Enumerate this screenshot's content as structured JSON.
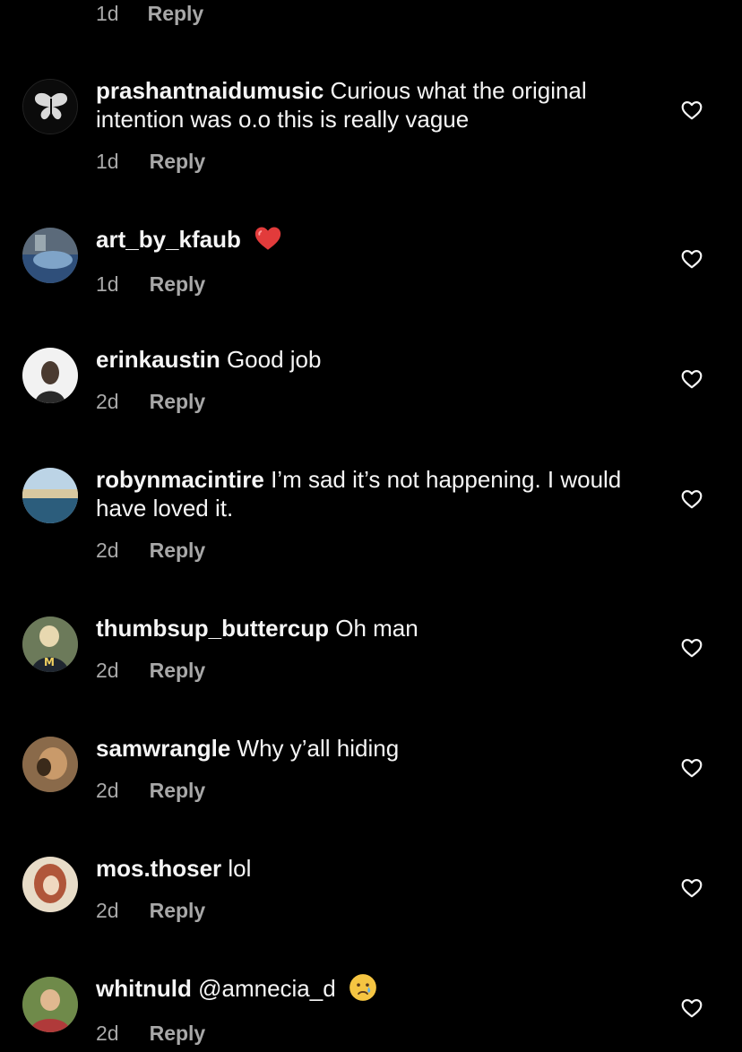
{
  "top_item": {
    "time": "1d",
    "reply": "Reply"
  },
  "comments": [
    {
      "username": "prashantnaidumusic",
      "text": "Curious what the original intention was o.o this is really vague",
      "time": "1d",
      "reply": "Reply",
      "avatar_icon": "butterfly-avatar-icon"
    },
    {
      "username": "art_by_kfaub",
      "text": "",
      "emoji": "red-heart-icon",
      "time": "1d",
      "reply": "Reply",
      "avatar_icon": "photo-avatar-icon"
    },
    {
      "username": "erinkaustin",
      "text": "Good job",
      "time": "2d",
      "reply": "Reply",
      "avatar_icon": "portrait-avatar-icon"
    },
    {
      "username": "robynmacintire",
      "text": "I’m sad it’s not happening. I would have loved it.",
      "time": "2d",
      "reply": "Reply",
      "avatar_icon": "beach-avatar-icon"
    },
    {
      "username": "thumbsup_buttercup",
      "text": "Oh man",
      "time": "2d",
      "reply": "Reply",
      "avatar_icon": "portrait-avatar-icon"
    },
    {
      "username": "samwrangle",
      "text": "Why y’all hiding",
      "time": "2d",
      "reply": "Reply",
      "avatar_icon": "portrait-avatar-icon"
    },
    {
      "username": "mos.thoser",
      "text": "lol",
      "time": "2d",
      "reply": "Reply",
      "avatar_icon": "illustration-avatar-icon"
    },
    {
      "username": "whitnuld",
      "text": "@amnecia_d",
      "emoji": "crying-face-icon",
      "time": "2d",
      "reply": "Reply",
      "avatar_icon": "portrait-avatar-icon"
    }
  ],
  "colors": {
    "background": "#000000",
    "text": "#f5f5f5",
    "muted": "#a8a8a8",
    "heart": "#ed4956"
  }
}
